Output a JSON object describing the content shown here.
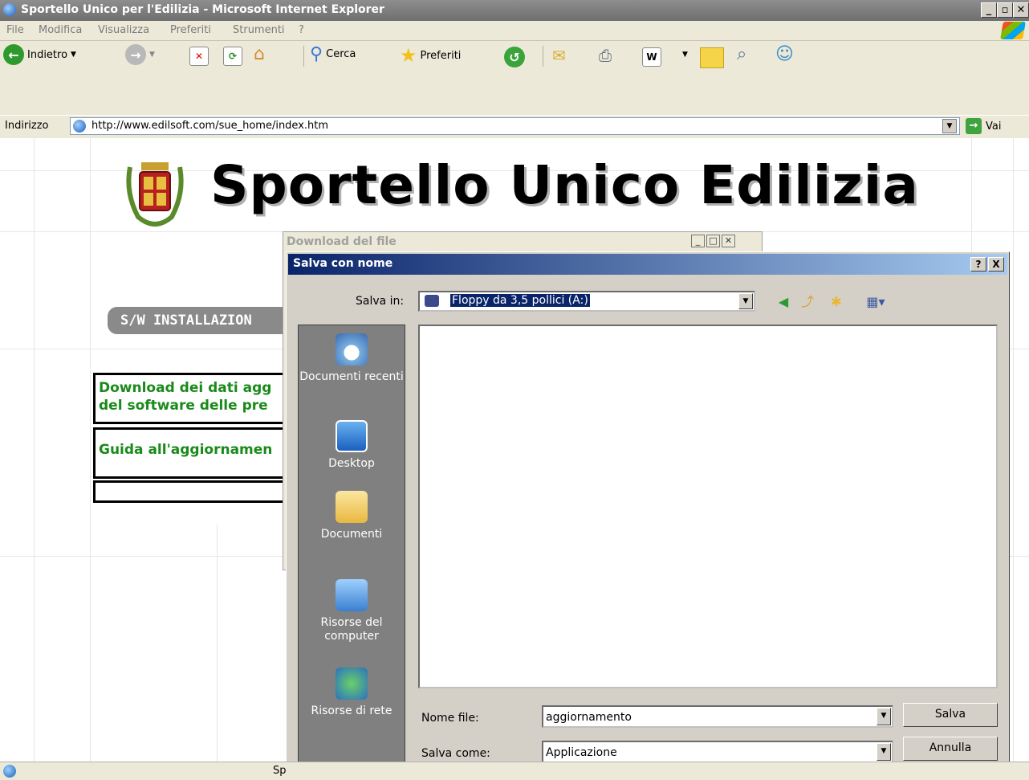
{
  "window": {
    "title": "Sportello Unico per l'Edilizia - Microsoft Internet Explorer",
    "controls": [
      "_",
      "ÑÍ",
      "X"
    ]
  },
  "menu": [
    "File",
    "Modifica",
    "Visualizza",
    "Preferiti",
    "Strumenti",
    "?"
  ],
  "toolbar": {
    "back_label": "Indietro",
    "search_label": "Cerca",
    "favorites_label": "Preferiti"
  },
  "address": {
    "label": "Indirizzo",
    "url": "http://www.edilsoft.com/sue_home/index.htm",
    "go_label": "Vai"
  },
  "page": {
    "title": "Sportello Unico Edilizia",
    "tab_label": "S/W INSTALLAZION",
    "links": [
      {
        "line1": "Download dei dati agg",
        "line2": "del software delle pre"
      },
      {
        "line1": "Guida all'aggiornamen",
        "line2": ""
      }
    ]
  },
  "download_dialog": {
    "title": "Download del file"
  },
  "save_dialog": {
    "title": "Salva con nome",
    "help": "?",
    "close": "X",
    "save_in_label": "Salva in:",
    "save_in_value": "Floppy da 3,5 pollici (A:)",
    "places": [
      {
        "label": "Documenti recenti",
        "icon": "recent-documents-icon"
      },
      {
        "label": "Desktop",
        "icon": "desktop-icon"
      },
      {
        "label": "Documenti",
        "icon": "my-documents-icon"
      },
      {
        "label": "Risorse del computer",
        "icon": "my-computer-icon"
      },
      {
        "label": "Risorse di rete",
        "icon": "network-icon"
      }
    ],
    "filename_label": "Nome file:",
    "filename_value": "aggiornamento",
    "filetype_label": "Salva come:",
    "filetype_value": "Applicazione",
    "save_button": "Salva",
    "cancel_button": "Annulla"
  },
  "status": {
    "text": "Sp"
  },
  "colors": {
    "dialog_title_start": "#0a246a",
    "dialog_title_end": "#a6caf0",
    "link_green": "#1a8a1a",
    "places_bar": "#808080"
  }
}
